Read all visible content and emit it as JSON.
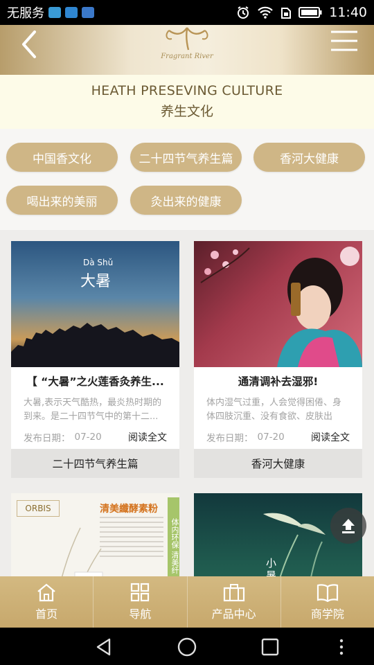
{
  "status_bar": {
    "carrier": "无服务",
    "time": "11:40"
  },
  "header": {
    "logo_text": "Fragrant River"
  },
  "title_band": {
    "title_en": "HEATH PRESEVING CULTURE",
    "title_cn": "养生文化"
  },
  "categories": [
    {
      "label": "中国香文化"
    },
    {
      "label": "二十四节气养生篇"
    },
    {
      "label": "香河大健康"
    },
    {
      "label": "喝出来的美丽"
    },
    {
      "label": "灸出来的健康"
    }
  ],
  "cards": [
    {
      "image_caption_pinyin": "Dà Shǔ",
      "image_caption_cn": "大暑",
      "title": "【 “大暑”之火莲香灸养生...",
      "desc": "大暑,表示天气酷热，最炎热时期的到来。是二十四节气中的第十二...",
      "date_label": "发布日期：",
      "date": "07-20",
      "read_more": "阅读全文",
      "tag": "二十四节气养生篇"
    },
    {
      "title": "通清调补去湿邪!",
      "desc": "体内湿气过重，人会觉得困倦、身体四肢沉重、没有食欲、皮肤出现...",
      "date_label": "发布日期：",
      "date": "07-20",
      "read_more": "阅读全文",
      "tag": "香河大健康"
    },
    {
      "image_brand": "ORBIS",
      "image_heading": "清美纖酵素粉",
      "image_side": "体内环保 清美纤"
    },
    {
      "image_caption_cn": "小暑"
    }
  ],
  "bottom_nav": [
    {
      "label": "首页",
      "icon": "home-icon"
    },
    {
      "label": "导航",
      "icon": "grid-icon"
    },
    {
      "label": "产品中心",
      "icon": "briefcase-icon"
    },
    {
      "label": "商学院",
      "icon": "book-icon"
    }
  ],
  "colors": {
    "gold": "#cfb686",
    "header_gold": "#c7a86c",
    "title_text": "#6b5a33"
  }
}
